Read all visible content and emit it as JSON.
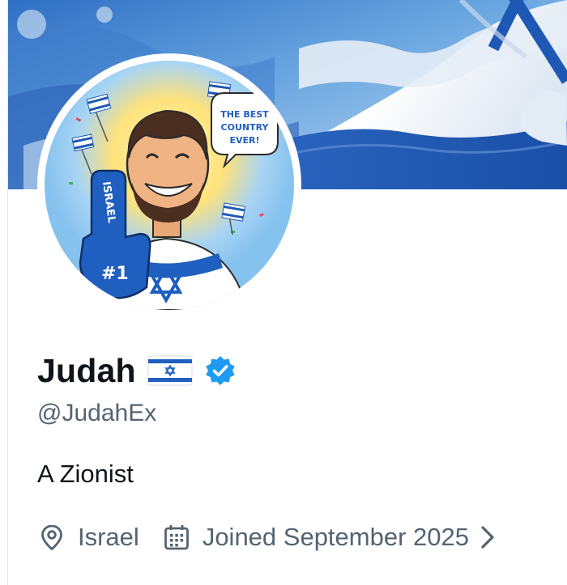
{
  "profile": {
    "display_name": "Judah",
    "handle": "@JudahEx",
    "bio": "A Zionist",
    "location": "Israel",
    "joined": "Joined September 2025"
  },
  "avatar": {
    "speech_bubble": "THE BEST COUNTRY EVER!",
    "finger_text": "ISRAEL",
    "finger_number": "#1"
  },
  "icons": {
    "name_flag": "israel-flag-emoji",
    "verified": "verified-badge-icon",
    "location": "location-pin-icon",
    "joined": "calendar-icon",
    "more": "chevron-right-icon"
  },
  "colors": {
    "verified": "#1d9bf0",
    "text_primary": "#0f1419",
    "text_secondary": "#536471",
    "flag_blue": "#1f5fbf"
  }
}
